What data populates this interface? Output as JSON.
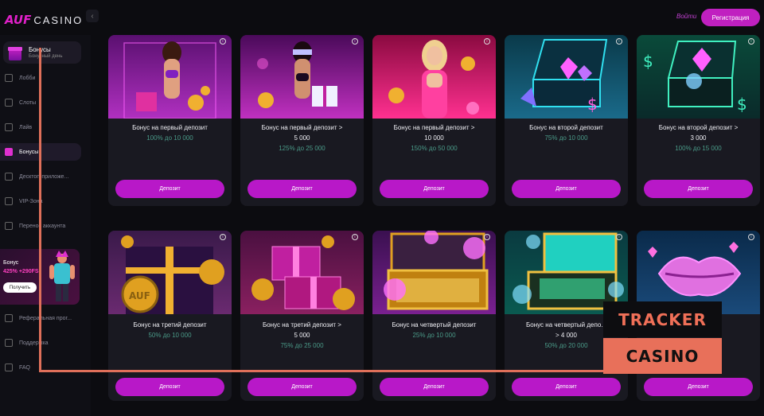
{
  "header": {
    "logo_auf": "AUF",
    "logo_casino": "CASINO",
    "login": "Войти",
    "register": "Регистрация"
  },
  "sidebar": {
    "promo": {
      "title": "Бонусы",
      "subtitle": "Бонусный день"
    },
    "items": [
      {
        "label": "Лобби",
        "icon": "home-icon",
        "active": false
      },
      {
        "label": "Слоты",
        "icon": "slots-icon",
        "active": false
      },
      {
        "label": "Лайв",
        "icon": "live-icon",
        "active": false
      },
      {
        "label": "Бонусы",
        "icon": "gift-icon",
        "active": true
      },
      {
        "label": "Десктоп-приложе...",
        "icon": "desktop-icon",
        "active": false
      },
      {
        "label": "VIP-Зона",
        "icon": "crown-icon",
        "active": false
      },
      {
        "label": "Перенос аккаунта",
        "icon": "transfer-icon",
        "active": false
      },
      {
        "label": "Реферальная прог...",
        "icon": "referral-icon",
        "active": false
      },
      {
        "label": "Поддержка",
        "icon": "support-icon",
        "active": false
      },
      {
        "label": "FAQ",
        "icon": "faq-icon",
        "active": false
      }
    ],
    "bonus_banner": {
      "title": "Бонус",
      "amount": "425% +290FS",
      "button": "Получить"
    }
  },
  "cards": [
    {
      "title": "Бонус на первый депозит",
      "percent": "100% до",
      "amount": "10 000",
      "button": "Депозит",
      "art": "purple-woman"
    },
    {
      "title": "Бонус на первый депозит >",
      "title2": "5 000",
      "percent": "125% до",
      "amount": "25 000",
      "button": "Депозит",
      "art": "masked-woman"
    },
    {
      "title": "Бонус на первый депозит >",
      "title2": "10 000",
      "percent": "150% до",
      "amount": "50 000",
      "button": "Депозит",
      "art": "blonde-woman"
    },
    {
      "title": "Бонус на второй депозит",
      "percent": "75% до",
      "amount": "10 000",
      "button": "Депозит",
      "art": "cyan-chest"
    },
    {
      "title": "Бонус на второй депозит >",
      "title2": "3 000",
      "percent": "100% до",
      "amount": "15 000",
      "button": "Депозит",
      "art": "green-chest"
    },
    {
      "title": "Бонус на третий депозит",
      "percent": "50% до",
      "amount": "10 000",
      "button": "Депозит",
      "art": "gold-gift"
    },
    {
      "title": "Бонус на третий депозит >",
      "title2": "5 000",
      "percent": "75% до",
      "amount": "25 000",
      "button": "Депозит",
      "art": "pink-gifts"
    },
    {
      "title": "Бонус на четвертый депозит",
      "percent": "25% до",
      "amount": "10 000",
      "button": "Депозит",
      "art": "gold-case"
    },
    {
      "title": "Бонус на четвертый депо...",
      "title2": "> 4 000",
      "percent": "50% до",
      "amount": "20 000",
      "button": "Депозит",
      "art": "teal-case"
    },
    {
      "title": "",
      "percent": "",
      "amount": "",
      "button": "Депозит",
      "art": "lips"
    }
  ],
  "overlay": {
    "tracker": "TRACKER",
    "casino": "CASINO"
  },
  "colors": {
    "accent": "#c020c0",
    "value": "#4a9a88",
    "overlay": "#e8705a"
  }
}
